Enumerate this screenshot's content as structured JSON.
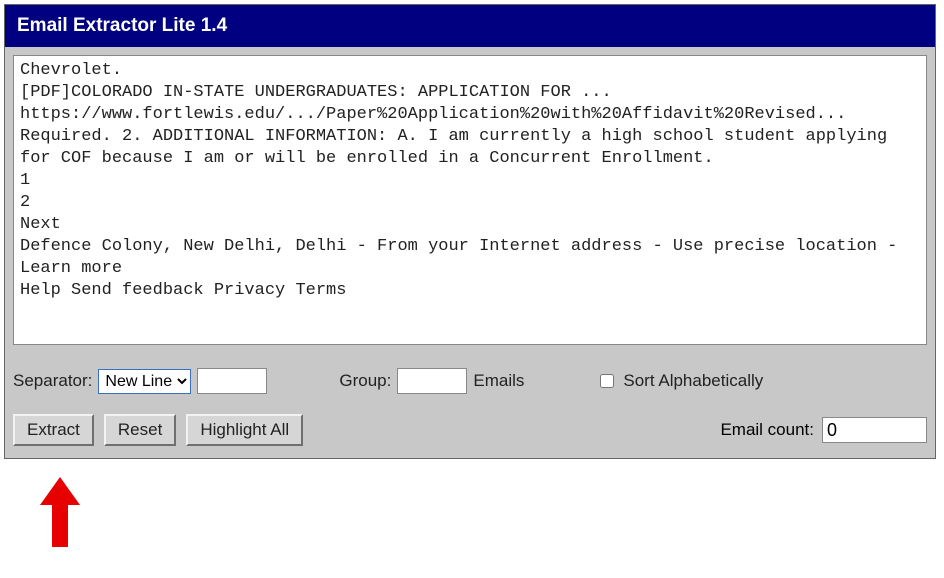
{
  "title": "Email Extractor Lite 1.4",
  "textarea_value": "Chevrolet.\n[PDF]COLORADO IN-STATE UNDERGRADUATES: APPLICATION FOR ...\nhttps://www.fortlewis.edu/.../Paper%20Application%20with%20Affidavit%20Revised...\nRequired. 2. ADDITIONAL INFORMATION: A. I am currently a high school student applying for COF because I am or will be enrolled in a Concurrent Enrollment.\n1\n2\nNext\nDefence Colony, New Delhi, Delhi - From your Internet address - Use precise location - Learn more\nHelp Send feedback Privacy Terms",
  "options": {
    "separator_label": "Separator:",
    "separator_selected": "New Line",
    "separator_custom_value": "",
    "group_label": "Group:",
    "group_value": "",
    "group_suffix": "Emails",
    "sort_label": "Sort Alphabetically",
    "sort_checked": false
  },
  "buttons": {
    "extract": "Extract",
    "reset": "Reset",
    "highlight": "Highlight All"
  },
  "count": {
    "label": "Email count:",
    "value": "0"
  },
  "colors": {
    "titlebar_bg": "#000080",
    "panel_bg": "#c8c8c8",
    "arrow": "#e60000"
  },
  "annotation": {
    "arrow_points_to": "extract-button"
  }
}
